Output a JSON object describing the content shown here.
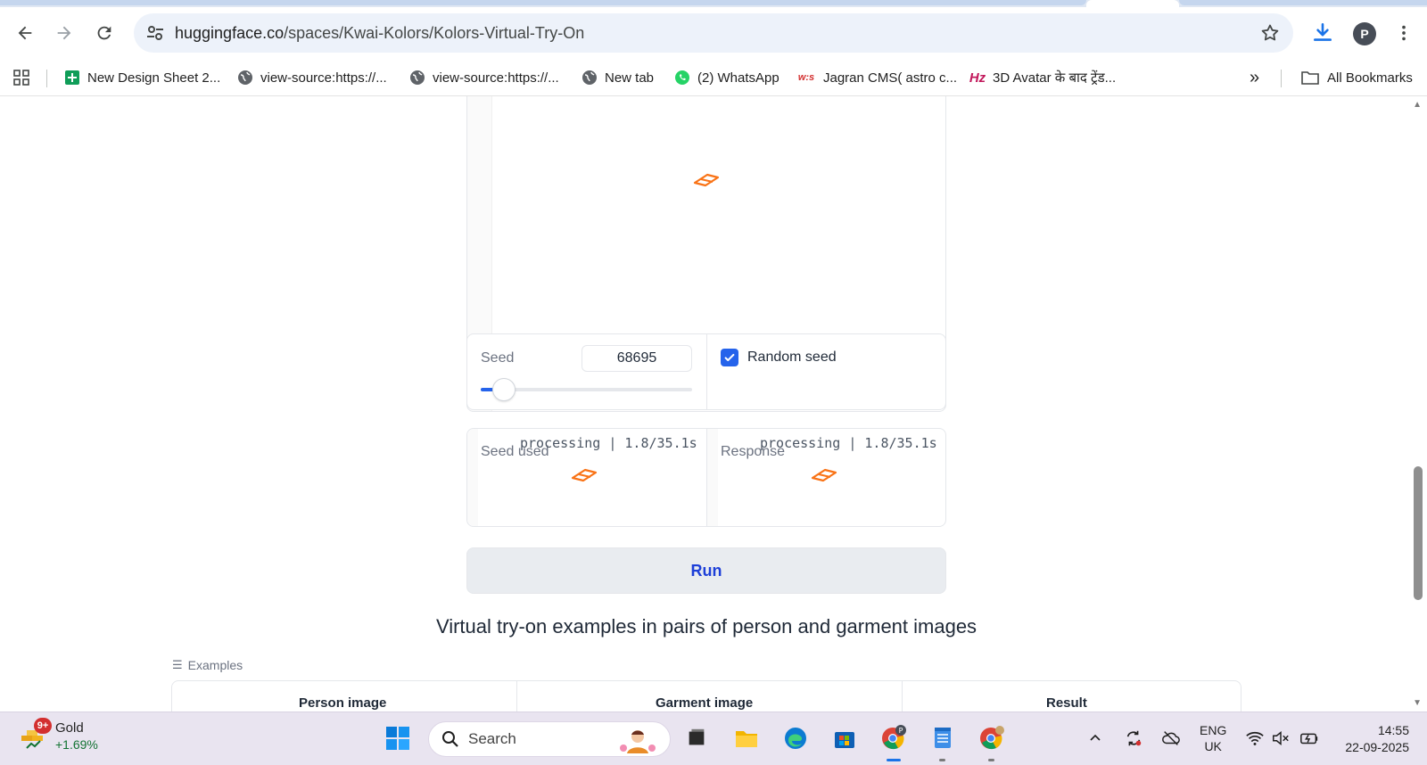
{
  "browser": {
    "url_host": "huggingface.co",
    "url_path": "/spaces/Kwai-Kolors/Kolors-Virtual-Try-On",
    "profile_initial": "P",
    "bookmarks": [
      {
        "label": "New Design Sheet 2...",
        "icon": "sheets-icon"
      },
      {
        "label": "view-source:https://...",
        "icon": "globe-icon"
      },
      {
        "label": "view-source:https://...",
        "icon": "globe-icon"
      },
      {
        "label": "New tab",
        "icon": "globe-icon"
      },
      {
        "label": "(2) WhatsApp",
        "icon": "whatsapp-icon"
      },
      {
        "label": "Jagran CMS( astro c...",
        "icon": "jagran-icon"
      },
      {
        "label": "3D Avatar के बाद ट्रेंड...",
        "icon": "hz-icon"
      }
    ],
    "all_bookmarks_label": "All Bookmarks",
    "more_label": "»"
  },
  "page": {
    "seed_label": "Seed",
    "seed_value": "68695",
    "seed_slider_fraction": 0.03,
    "random_seed_label": "Random seed",
    "random_seed_checked": true,
    "seed_used_label": "Seed used",
    "response_label": "Response",
    "progress_text": "processing | 1.8/35.1s",
    "run_label": "Run",
    "section_title": "Virtual try-on examples in pairs of person and garment images",
    "examples_label": "Examples",
    "table_headers": [
      "Person image",
      "Garment image",
      "Result"
    ]
  },
  "taskbar": {
    "weather_name": "Gold",
    "weather_change": "+1.69%",
    "weather_badge": "9+",
    "search_placeholder": "Search",
    "lang_line1": "ENG",
    "lang_line2": "UK",
    "time": "14:55",
    "date": "22-09-2025"
  },
  "colors": {
    "accent": "#2563eb",
    "run_text": "#1d3fd8",
    "loader": "#f97316",
    "omnibox_bg": "#edf2fa",
    "taskbar_bg": "#e9e4f0"
  }
}
